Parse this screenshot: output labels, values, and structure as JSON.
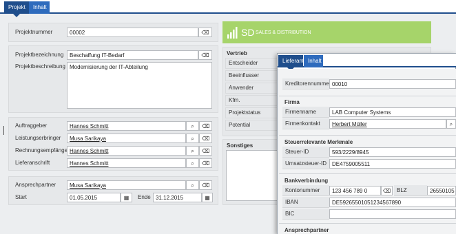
{
  "main": {
    "tabs": [
      {
        "label": "Projekt"
      },
      {
        "label": "Inhalt"
      }
    ],
    "fields": {
      "projektnummer": {
        "label": "Projektnummer",
        "value": "00002"
      },
      "projektbezeichnung": {
        "label": "Projektbezeichnung",
        "value": "Beschaffung IT-Bedarf"
      },
      "projektbeschreibung": {
        "label": "Projektbeschreibung",
        "value": "Modernisierung der IT-Abteilung"
      },
      "auftraggeber": {
        "label": "Auftraggeber",
        "value": "Hannes Schmitt"
      },
      "leistungserbringer": {
        "label": "Leistungserbringer",
        "value": "Musa Sarikaya"
      },
      "rechnungsempfaenger": {
        "label": "Rechnungsempfänger",
        "value": "Hannes Schmitt"
      },
      "lieferanschrift": {
        "label": "Lieferanschrift",
        "value": "Hannes Schmitt"
      },
      "ansprechpartner": {
        "label": "Ansprechpartner",
        "value": "Musa Sarikaya"
      },
      "start": {
        "label": "Start",
        "value": "01.05.2015"
      },
      "ende": {
        "label": "Ende",
        "value": "31.12.2015"
      }
    },
    "banner": {
      "abbr": "SD",
      "text": "SALES & DISTRIBUTION"
    },
    "vertrieb": {
      "title": "Vertrieb",
      "rows": [
        "Entscheider",
        "Beeinflusser",
        "Anwender",
        "Kfm. Ansprechpartner",
        "Projektstatus",
        "Potential"
      ]
    },
    "sonstiges": {
      "title": "Sonstiges"
    }
  },
  "overlay": {
    "tabs": [
      {
        "label": "Lieferant"
      },
      {
        "label": "Inhalt"
      }
    ],
    "kreditorennummer": {
      "label": "Kreditorennummer",
      "value": "00010"
    },
    "firma": {
      "title": "Firma",
      "firmenname": {
        "label": "Firmenname",
        "value": "LAB Computer Systems"
      },
      "firmenkontakt": {
        "label": "Firmenkontakt",
        "value": "Herbert Müller"
      }
    },
    "steuer": {
      "title": "Steuerrelevante Merkmale",
      "steuer_id": {
        "label": "Steuer-ID",
        "value": "593/2229/8945"
      },
      "umsatzsteuer_id": {
        "label": "Umsatzsteuer-ID",
        "value": "DE4759005511"
      }
    },
    "bank": {
      "title": "Bankverbindung",
      "kontonummer": {
        "label": "Kontonummer",
        "value": "123 456 789 0"
      },
      "blz": {
        "label": "BLZ",
        "value": "26550105"
      },
      "iban": {
        "label": "IBAN",
        "value": "DE59265501051234567890"
      },
      "bic": {
        "label": "BIC",
        "value": ""
      }
    },
    "ansprechpartner": {
      "title": "Ansprechpartner"
    }
  },
  "icons": {
    "clear": "⌫",
    "search": "⌕",
    "calendar": "▦"
  },
  "colors": {
    "tab_active": "#1f4e8c",
    "tab_inactive": "#2e6bbd",
    "banner": "#a6d46a"
  }
}
